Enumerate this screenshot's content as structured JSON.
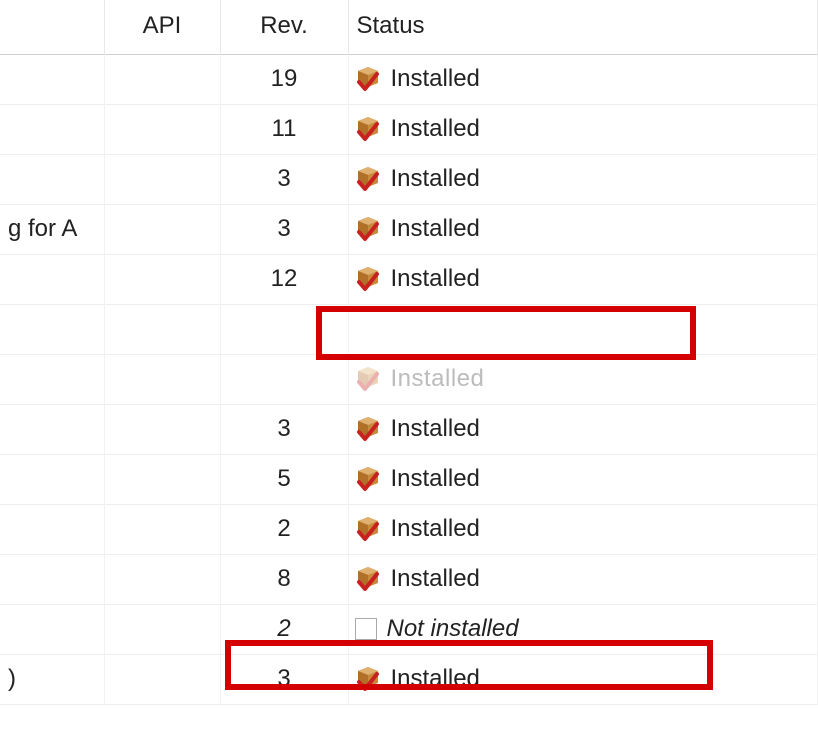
{
  "columns": {
    "name": "",
    "api": "API",
    "rev": "Rev.",
    "status": "Status"
  },
  "status_labels": {
    "installed": "Installed",
    "not_installed": "Not installed",
    "smudged": "Installed"
  },
  "rows": [
    {
      "name": "",
      "api": "",
      "rev": "19",
      "status_key": "installed"
    },
    {
      "name": "",
      "api": "",
      "rev": "11",
      "status_key": "installed"
    },
    {
      "name": "",
      "api": "",
      "rev": "3",
      "status_key": "installed"
    },
    {
      "name": "g for A",
      "api": "",
      "rev": "3",
      "status_key": "installed"
    },
    {
      "name": "",
      "api": "",
      "rev": "12",
      "status_key": "installed"
    },
    {
      "name": "",
      "api": "",
      "rev": "",
      "status_key": "",
      "obscured": true
    },
    {
      "name": "",
      "api": "",
      "rev": "",
      "status_key": "smudged",
      "smudged": true
    },
    {
      "name": "",
      "api": "",
      "rev": "3",
      "status_key": "installed"
    },
    {
      "name": "",
      "api": "",
      "rev": "5",
      "status_key": "installed"
    },
    {
      "name": "",
      "api": "",
      "rev": "2",
      "status_key": "installed"
    },
    {
      "name": "",
      "api": "",
      "rev": "8",
      "status_key": "installed"
    },
    {
      "name": "",
      "api": "",
      "rev": "2",
      "status_key": "not_installed",
      "italic": true
    },
    {
      "name": ")",
      "api": "",
      "rev": "3",
      "status_key": "installed"
    }
  ]
}
